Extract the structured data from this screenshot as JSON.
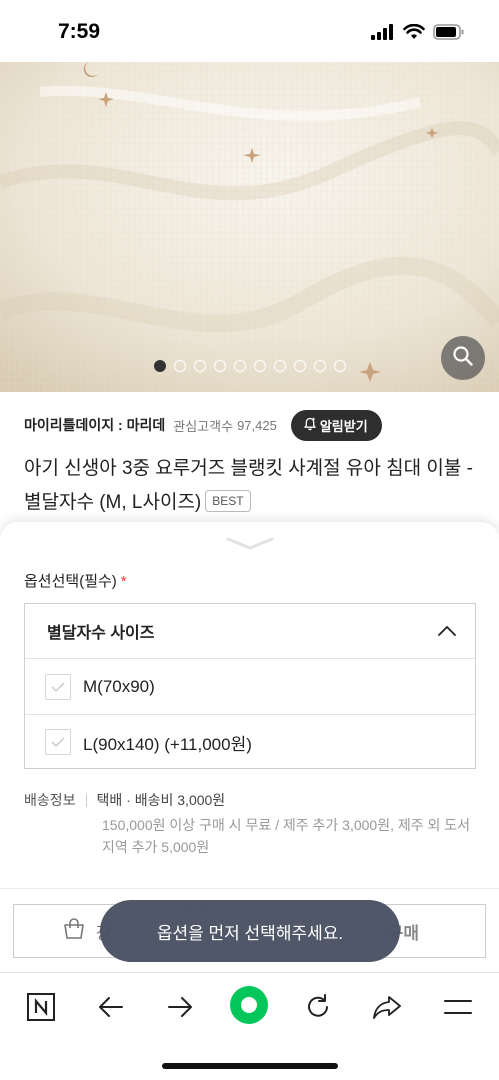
{
  "status_bar": {
    "time": "7:59",
    "icons": [
      "signal-bars-icon",
      "wifi-icon",
      "battery-icon"
    ]
  },
  "product_image": {
    "description_icon": "fabric-photo",
    "carousel_total": 10,
    "carousel_active_index": 0,
    "zoom_icon": "search-icon"
  },
  "seller": {
    "name": "마이리틀데이지 : 마리데",
    "interest_label": "관심고객수",
    "interest_count": "97,425",
    "alarm_label": "알림받기",
    "alarm_icon": "bell-plus-icon"
  },
  "product": {
    "title": "아기 신생아 3중 요루거즈 블랭킷 사계절 유아 침대 이불 - 별달자수 (M, L사이즈)",
    "badge": "BEST"
  },
  "sheet": {
    "option_label": "옵션선택(필수)",
    "required_mark": "*",
    "option_group": {
      "label": "별달자수 사이즈",
      "expanded": true,
      "options": [
        {
          "label": "M(70x90)",
          "checked": false
        },
        {
          "label": "L(90x140) (+11,000원)",
          "checked": false
        }
      ]
    },
    "shipping": {
      "label": "배송정보",
      "fee": "택배 · 배송비 3,000원",
      "note": "150,000원 이상 구매 시 무료 / 제주 추가 3,000원, 제주 외 도서지역 추가 5,000원"
    },
    "cart_button_label": "장",
    "buy_button_label": "구매"
  },
  "toast": {
    "message": "옵션을 먼저 선택해주세요."
  },
  "toolbar": {
    "items": [
      "naver-n-icon",
      "back-arrow-icon",
      "forward-arrow-icon",
      "green-home-icon",
      "refresh-icon",
      "share-icon",
      "menu-icon"
    ]
  },
  "colors": {
    "accent_green": "#03c75a",
    "toast_bg": "#485062",
    "alarm_bg": "#2e2e2e",
    "required": "#e53e3e"
  }
}
